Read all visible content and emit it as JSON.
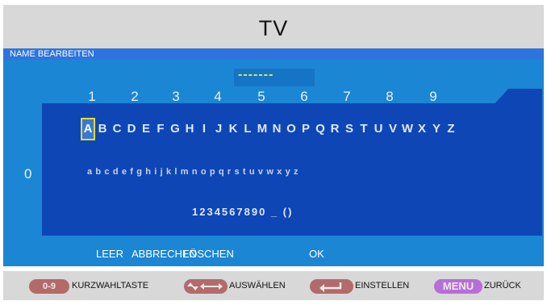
{
  "title": "TV",
  "section_label": "NAME BEARBEITEN",
  "name_field_value": "-------",
  "digit_header": [
    "1",
    "2",
    "3",
    "4",
    "5",
    "6",
    "7",
    "8",
    "9"
  ],
  "left_index": "0",
  "upper_letters": [
    "A",
    "B",
    "C",
    "D",
    "E",
    "F",
    "G",
    "H",
    "I",
    "J",
    "K",
    "L",
    "M",
    "N",
    "O",
    "P",
    "Q",
    "R",
    "S",
    "T",
    "U",
    "V",
    "W",
    "X",
    "Y",
    "Z"
  ],
  "lower_letters": "abcdefghijklmnopqrstuvwxyz",
  "digits_row": "1234567890 _ ()",
  "actions": {
    "leer": "LEER",
    "abbrechen": "ABBRECHEN",
    "loeschen": "LÖSCHEN",
    "ok": "OK"
  },
  "legend": {
    "key_09": "0-9",
    "kurzwahl": "KURZWAHLTASTE",
    "arrows_icon": "arrow-keys-icon",
    "auswaehlen": "AUSWÄHLEN",
    "enter_icon": "enter-key-icon",
    "einstellen": "EINSTELLEN",
    "menu": "MENU",
    "zurueck": "ZURÜCK"
  },
  "colors": {
    "main_bg": "#1b86d4",
    "panel_bg": "#0e46b6",
    "header_strip": "#2f74dd",
    "highlight": "#e6dc2a",
    "pill_red": "#b36a6a",
    "pill_purple": "#b56fd6"
  }
}
